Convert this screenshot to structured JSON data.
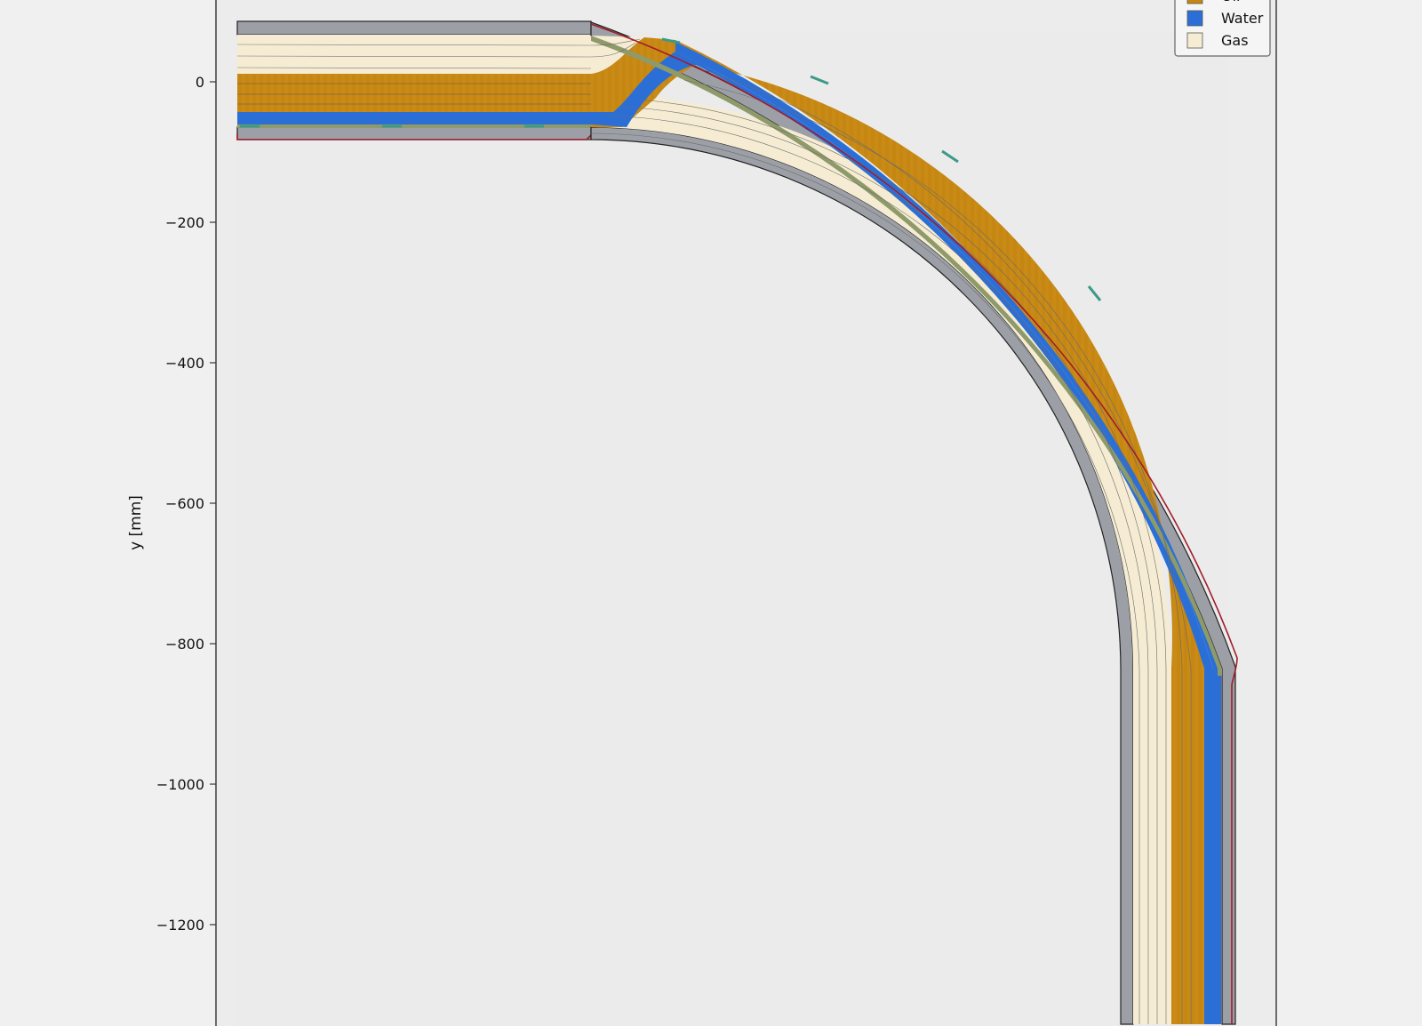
{
  "chart_data": {
    "type": "diagram",
    "description_free": true,
    "ylabel": "y [mm]",
    "y_ticks": [
      0,
      -200,
      -400,
      -600,
      -800,
      -1000,
      -1200
    ],
    "y_tick_labels": [
      "0",
      "−200",
      "−400",
      "−600",
      "−800",
      "−1000",
      "−1200"
    ],
    "ylim": [
      -1345,
      115
    ],
    "legend": {
      "placement": "top-right",
      "entries": [
        {
          "label": "Oil",
          "color": "#c58612"
        },
        {
          "label": "Water",
          "color": "#2b6fd6"
        },
        {
          "label": "Gas",
          "color": "#f5ecd3"
        }
      ]
    },
    "colors": {
      "wall": "#9ca0a6",
      "oil": "#c58612",
      "water": "#2b6fd6",
      "gas": "#f5ecd3",
      "interface": "#8f9a6a",
      "droplet": "#3c9a88",
      "outer_line": "#a11c2c",
      "axes_bg": "#ececec"
    }
  }
}
